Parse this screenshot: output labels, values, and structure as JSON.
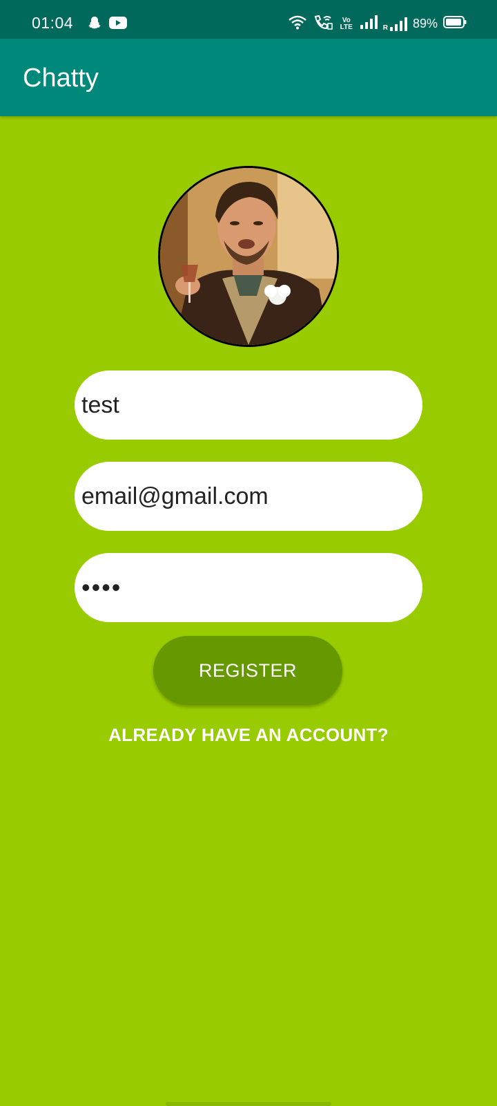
{
  "status_bar": {
    "time": "01:04",
    "battery_percent": "89%",
    "volte_label": "Vo LTE",
    "roaming_label": "R",
    "icons": [
      "snapchat-icon",
      "youtube-icon",
      "wifi-icon",
      "wifi-calling-icon",
      "volte-icon",
      "signal-icon",
      "roaming-signal-icon",
      "battery-icon"
    ]
  },
  "app_bar": {
    "title": "Chatty"
  },
  "form": {
    "profile_image_label": "profile-photo",
    "name_value": "test",
    "email_value": "email@gmail.com",
    "password_value": "••••",
    "register_label": "REGISTER",
    "login_link_label": "ALREADY HAVE AN ACCOUNT?"
  },
  "colors": {
    "status_bar": "#00695c",
    "app_bar": "#00897b",
    "background": "#99cc00",
    "button": "#669900"
  }
}
